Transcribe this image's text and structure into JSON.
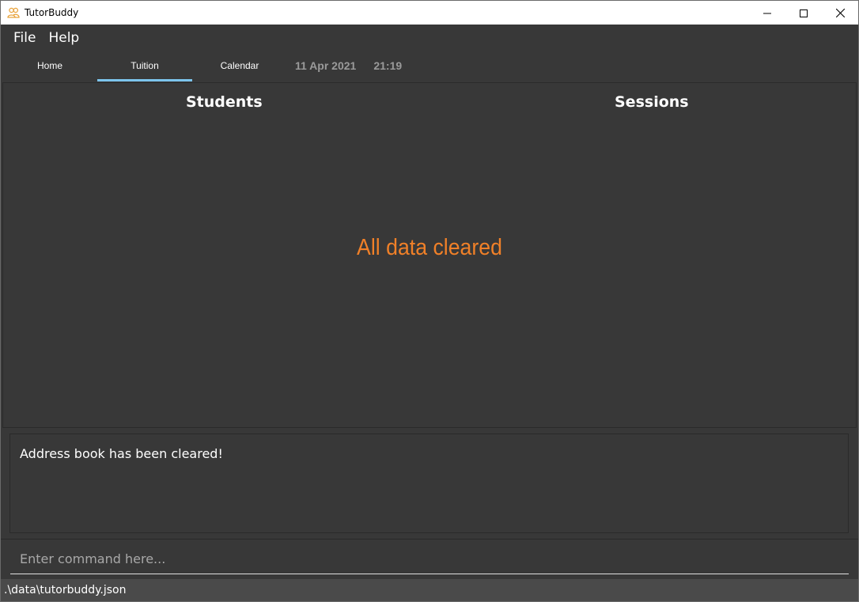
{
  "window": {
    "title": "TutorBuddy",
    "icon": "people-icon",
    "controls": [
      "minimize-icon",
      "maximize-icon",
      "close-icon"
    ]
  },
  "menu": {
    "items": [
      {
        "label": "File"
      },
      {
        "label": "Help"
      }
    ]
  },
  "tabs": [
    {
      "label": "Home",
      "active": false
    },
    {
      "label": "Tuition",
      "active": true
    },
    {
      "label": "Calendar",
      "active": false
    }
  ],
  "datetime": {
    "date": "11 Apr 2021",
    "time": "21:19"
  },
  "main": {
    "students_heading": "Students",
    "sessions_heading": "Sessions",
    "message": "All data cleared"
  },
  "result": {
    "text": "Address book has been cleared!"
  },
  "command": {
    "placeholder": "Enter command here..."
  },
  "status": {
    "path": ".\\data\\tutorbuddy.json"
  },
  "colors": {
    "background": "#383838",
    "accent_tab_underline": "#7cc4ec",
    "message": "#f08028",
    "status_bar": "#4a4a4a",
    "app_icon": "#e8a23a"
  }
}
